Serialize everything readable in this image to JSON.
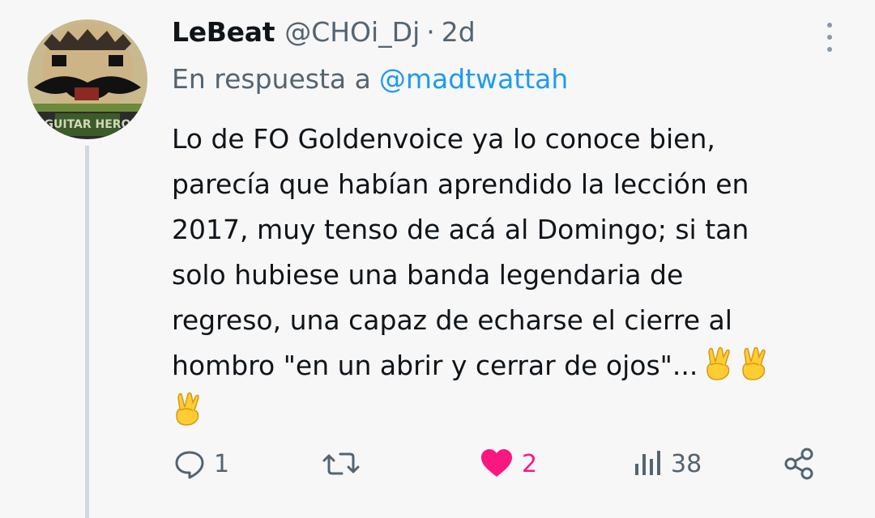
{
  "author": {
    "display_name": "LeBeat",
    "handle": "@CHOi_Dj",
    "separator": "·",
    "timestamp": "2d",
    "avatar_icon": "avatar-icon",
    "avatar_text": "GUITAR HERO"
  },
  "reply_to": {
    "prefix": "En respuesta a",
    "mention": "@madtwattah"
  },
  "body": {
    "lines": [
      "Lo de FO Goldenvoice ya lo conoce bien,",
      "parecía que habían aprendido la lección en",
      "2017, muy tenso de acá al Domingo; si tan",
      "solo hubiese una banda legendaria de",
      "regreso, una capaz de echarse el cierre al",
      "hombro \"en un abrir y cerrar de ojos\"..."
    ],
    "emoji_name": "crossed-fingers-emoji"
  },
  "actions": {
    "reply": {
      "icon": "reply-icon",
      "count": "1"
    },
    "retweet": {
      "icon": "retweet-icon",
      "count": ""
    },
    "like": {
      "icon": "heart-icon",
      "count": "2",
      "color": "#f91880"
    },
    "views": {
      "icon": "views-icon",
      "count": "38"
    },
    "share": {
      "icon": "share-icon"
    }
  },
  "colors": {
    "background": "#f7f7f7",
    "text": "#0f1419",
    "secondary": "#536471",
    "link": "#1d9bf0",
    "like": "#f91880",
    "thread_line": "#cfd9de"
  }
}
